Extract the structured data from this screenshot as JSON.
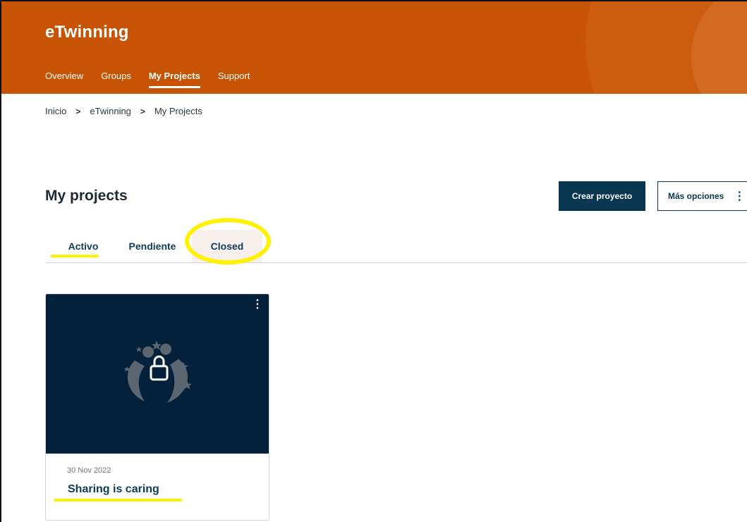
{
  "header": {
    "brand": "eTwinning",
    "nav": [
      {
        "label": "Overview"
      },
      {
        "label": "Groups"
      },
      {
        "label": "My Projects",
        "active": true
      },
      {
        "label": "Support"
      }
    ]
  },
  "breadcrumb": [
    "Inicio",
    "eTwinning",
    "My Projects"
  ],
  "page": {
    "title": "My projects",
    "create_button": "Crear proyecto",
    "more_options_button": "Más opciones"
  },
  "tabs": [
    {
      "label": "Activo",
      "active": true
    },
    {
      "label": "Pendiente"
    },
    {
      "label": "Closed"
    }
  ],
  "projects": [
    {
      "date": "30 Nov 2022",
      "title": "Sharing is caring",
      "icon": "lock-icon"
    }
  ],
  "colors": {
    "header_bg": "#c75304",
    "primary": "#073650",
    "card_image_bg": "#03213a",
    "annotation": "#fff200"
  }
}
